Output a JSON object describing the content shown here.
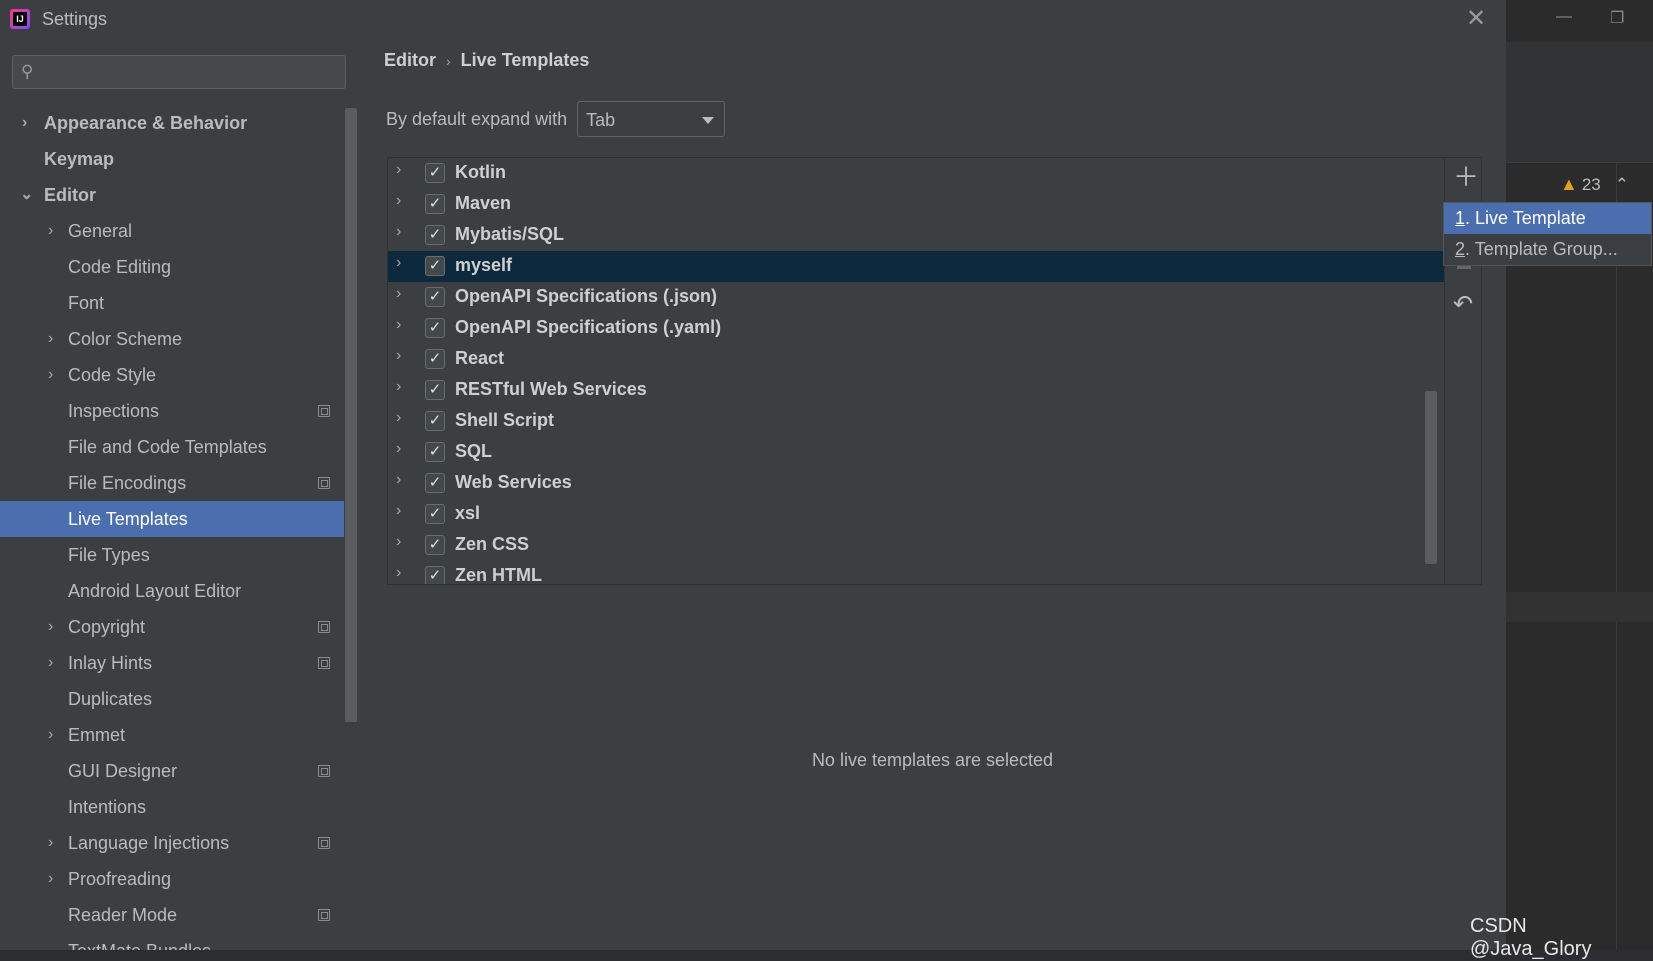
{
  "window": {
    "title": "Settings"
  },
  "search": {
    "placeholder": "",
    "value": ""
  },
  "sidebar": {
    "items": [
      {
        "label": "Appearance & Behavior"
      },
      {
        "label": "Keymap"
      },
      {
        "label": "Editor"
      },
      {
        "label": "General"
      },
      {
        "label": "Code Editing"
      },
      {
        "label": "Font"
      },
      {
        "label": "Color Scheme"
      },
      {
        "label": "Code Style"
      },
      {
        "label": "Inspections"
      },
      {
        "label": "File and Code Templates"
      },
      {
        "label": "File Encodings"
      },
      {
        "label": "Live Templates"
      },
      {
        "label": "File Types"
      },
      {
        "label": "Android Layout Editor"
      },
      {
        "label": "Copyright"
      },
      {
        "label": "Inlay Hints"
      },
      {
        "label": "Duplicates"
      },
      {
        "label": "Emmet"
      },
      {
        "label": "GUI Designer"
      },
      {
        "label": "Intentions"
      },
      {
        "label": "Language Injections"
      },
      {
        "label": "Proofreading"
      },
      {
        "label": "Reader Mode"
      },
      {
        "label": "TextMate Bundles"
      }
    ]
  },
  "breadcrumb": {
    "parent": "Editor",
    "separator": "›",
    "current": "Live Templates"
  },
  "expand": {
    "label": "By default expand with",
    "value": "Tab"
  },
  "template_groups": [
    {
      "name": "Kotlin",
      "checked": true
    },
    {
      "name": "Maven",
      "checked": true
    },
    {
      "name": "Mybatis/SQL",
      "checked": true
    },
    {
      "name": "myself",
      "checked": true
    },
    {
      "name": "OpenAPI Specifications (.json)",
      "checked": true
    },
    {
      "name": "OpenAPI Specifications (.yaml)",
      "checked": true
    },
    {
      "name": "React",
      "checked": true
    },
    {
      "name": "RESTful Web Services",
      "checked": true
    },
    {
      "name": "Shell Script",
      "checked": true
    },
    {
      "name": "SQL",
      "checked": true
    },
    {
      "name": "Web Services",
      "checked": true
    },
    {
      "name": "xsl",
      "checked": true
    },
    {
      "name": "Zen CSS",
      "checked": true
    },
    {
      "name": "Zen HTML",
      "checked": true
    }
  ],
  "empty_message": "No live templates are selected",
  "add_popup": {
    "items": [
      {
        "mnemonic": "1",
        "label": ". Live Template"
      },
      {
        "mnemonic": "2",
        "label": ". Template Group..."
      }
    ]
  },
  "ide": {
    "warnings_count": "23"
  },
  "watermark": "CSDN @Java_Glory",
  "colors": {
    "selection": "#4b6eaf",
    "row_selected": "#0d293e",
    "background": "#3c3f41"
  }
}
